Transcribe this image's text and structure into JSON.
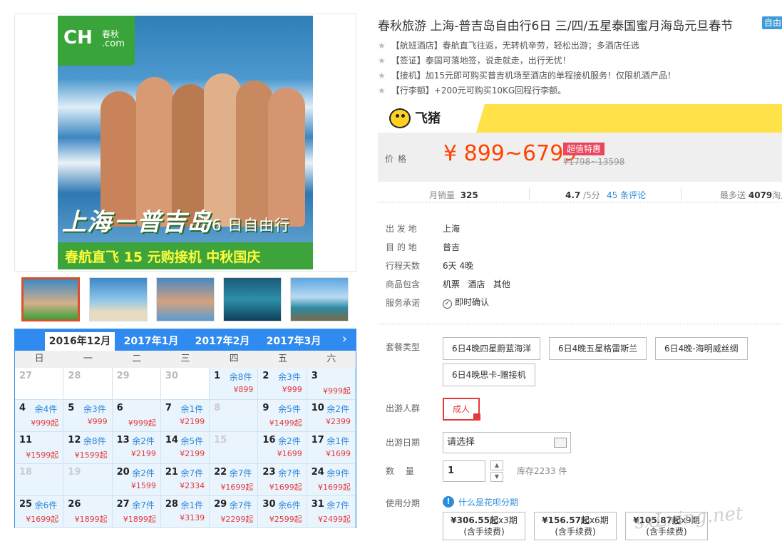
{
  "banner": {
    "logo_text": "CH",
    "logo_cn": "春秋",
    "logo_com": ".com",
    "title_main": "上海－普吉岛",
    "title_suffix": "6 日自由行",
    "subtitle": "春航直飞 15 元购接机 中秋国庆"
  },
  "calendar": {
    "months": [
      "2016年12月",
      "2017年1月",
      "2017年2月",
      "2017年3月"
    ],
    "selected_month": "2016年12月",
    "next_icon": "›",
    "weekdays": [
      "日",
      "一",
      "二",
      "三",
      "四",
      "五",
      "六"
    ],
    "days": [
      {
        "d": "27",
        "off": true
      },
      {
        "d": "28",
        "off": true
      },
      {
        "d": "29",
        "off": true
      },
      {
        "d": "30",
        "off": true
      },
      {
        "d": "1",
        "s": "余8件",
        "p": "¥899"
      },
      {
        "d": "2",
        "s": "余3件",
        "p": "¥999"
      },
      {
        "d": "3",
        "p": "¥999起"
      },
      {
        "d": "4",
        "s": "余4件",
        "p": "¥999起"
      },
      {
        "d": "5",
        "s": "余3件",
        "p": "¥999"
      },
      {
        "d": "6",
        "p": "¥999起"
      },
      {
        "d": "7",
        "s": "余1件",
        "p": "¥2199"
      },
      {
        "d": "8",
        "grey": true
      },
      {
        "d": "9",
        "s": "余5件",
        "p": "¥1499起"
      },
      {
        "d": "10",
        "s": "余2件",
        "p": "¥2399"
      },
      {
        "d": "11",
        "p": "¥1599起"
      },
      {
        "d": "12",
        "s": "余8件",
        "p": "¥1599起"
      },
      {
        "d": "13",
        "s": "余2件",
        "p": "¥2199"
      },
      {
        "d": "14",
        "s": "余5件",
        "p": "¥2199"
      },
      {
        "d": "15",
        "grey": true
      },
      {
        "d": "16",
        "s": "余2件",
        "p": "¥1699"
      },
      {
        "d": "17",
        "s": "余1件",
        "p": "¥1699"
      },
      {
        "d": "18",
        "grey": true
      },
      {
        "d": "19",
        "grey": true
      },
      {
        "d": "20",
        "s": "余2件",
        "p": "¥1599"
      },
      {
        "d": "21",
        "s": "余7件",
        "p": "¥2334"
      },
      {
        "d": "22",
        "s": "余7件",
        "p": "¥1699起"
      },
      {
        "d": "23",
        "s": "余7件",
        "p": "¥1699起"
      },
      {
        "d": "24",
        "s": "余9件",
        "p": "¥1699起"
      },
      {
        "d": "25",
        "s": "余6件",
        "p": "¥1699起"
      },
      {
        "d": "26",
        "p": "¥1899起"
      },
      {
        "d": "27",
        "s": "余7件",
        "p": "¥1899起"
      },
      {
        "d": "28",
        "s": "余1件",
        "p": "¥3139"
      },
      {
        "d": "29",
        "s": "余7件",
        "p": "¥2299起"
      },
      {
        "d": "30",
        "s": "余6件",
        "p": "¥2599起"
      },
      {
        "d": "31",
        "s": "余7件",
        "p": "¥2499起"
      }
    ]
  },
  "product": {
    "title": "春秋旅游 上海-普吉岛自由行6日 三/四/五星泰国蜜月海岛元旦春节",
    "title_tag": "自由",
    "features": [
      "【航班酒店】春航直飞往返，无转机辛劳，轻松出游；多酒店任选",
      "【签证】泰国可落地签，说走就走，出行无忧！",
      "【接机】加15元即可购买普吉机场至酒店的单程接机服务！仅限机酒产品！",
      "【行李额】+200元可购买10KG回程行李额。"
    ]
  },
  "price": {
    "brand": "飞猪",
    "label": "价格",
    "value": "¥ 899~6799",
    "tag": "超值特惠",
    "old": "¥1798~13598"
  },
  "stats": {
    "monthly_label": "月销量",
    "monthly_value": "325",
    "rating": "4.7",
    "rating_suffix": "/5分",
    "reviews": "45 条评论",
    "points_label": "最多送",
    "points_value": "4079",
    "points_suffix": "淘里"
  },
  "info": [
    {
      "label": "出 发 地",
      "value": "上海"
    },
    {
      "label": "目 的 地",
      "value": "普吉"
    },
    {
      "label": "行程天数",
      "value": "6天 4晚"
    },
    {
      "label": "商品包含",
      "value": "机票   酒店   其他"
    },
    {
      "label": "服务承诺",
      "value": "即时确认"
    }
  ],
  "options": {
    "package_label": "套餐类型",
    "packages": [
      "6日4晚四星蔚蓝海洋",
      "6日4晚五星格雷斯兰",
      "6日4晚-海明威丝绸",
      "6日4晚思卡-赠接机"
    ],
    "people_label": "出游人群",
    "people_value": "成人",
    "date_label": "出游日期",
    "date_placeholder": "请选择",
    "qty_label": "数 量",
    "qty_value": "1",
    "stock": "库存2233 件",
    "installment_label": "使用分期",
    "installment_link": "什么是花呗分期",
    "installments": [
      {
        "amount": "¥306.55起",
        "term": "x3期",
        "fee": "(含手续费)"
      },
      {
        "amount": "¥156.57起",
        "term": "x6期",
        "fee": "(含手续费)"
      },
      {
        "amount": "¥105.87起",
        "term": "x9期",
        "fee": "(含手续费)"
      }
    ]
  },
  "watermark": "sxLxing.net"
}
